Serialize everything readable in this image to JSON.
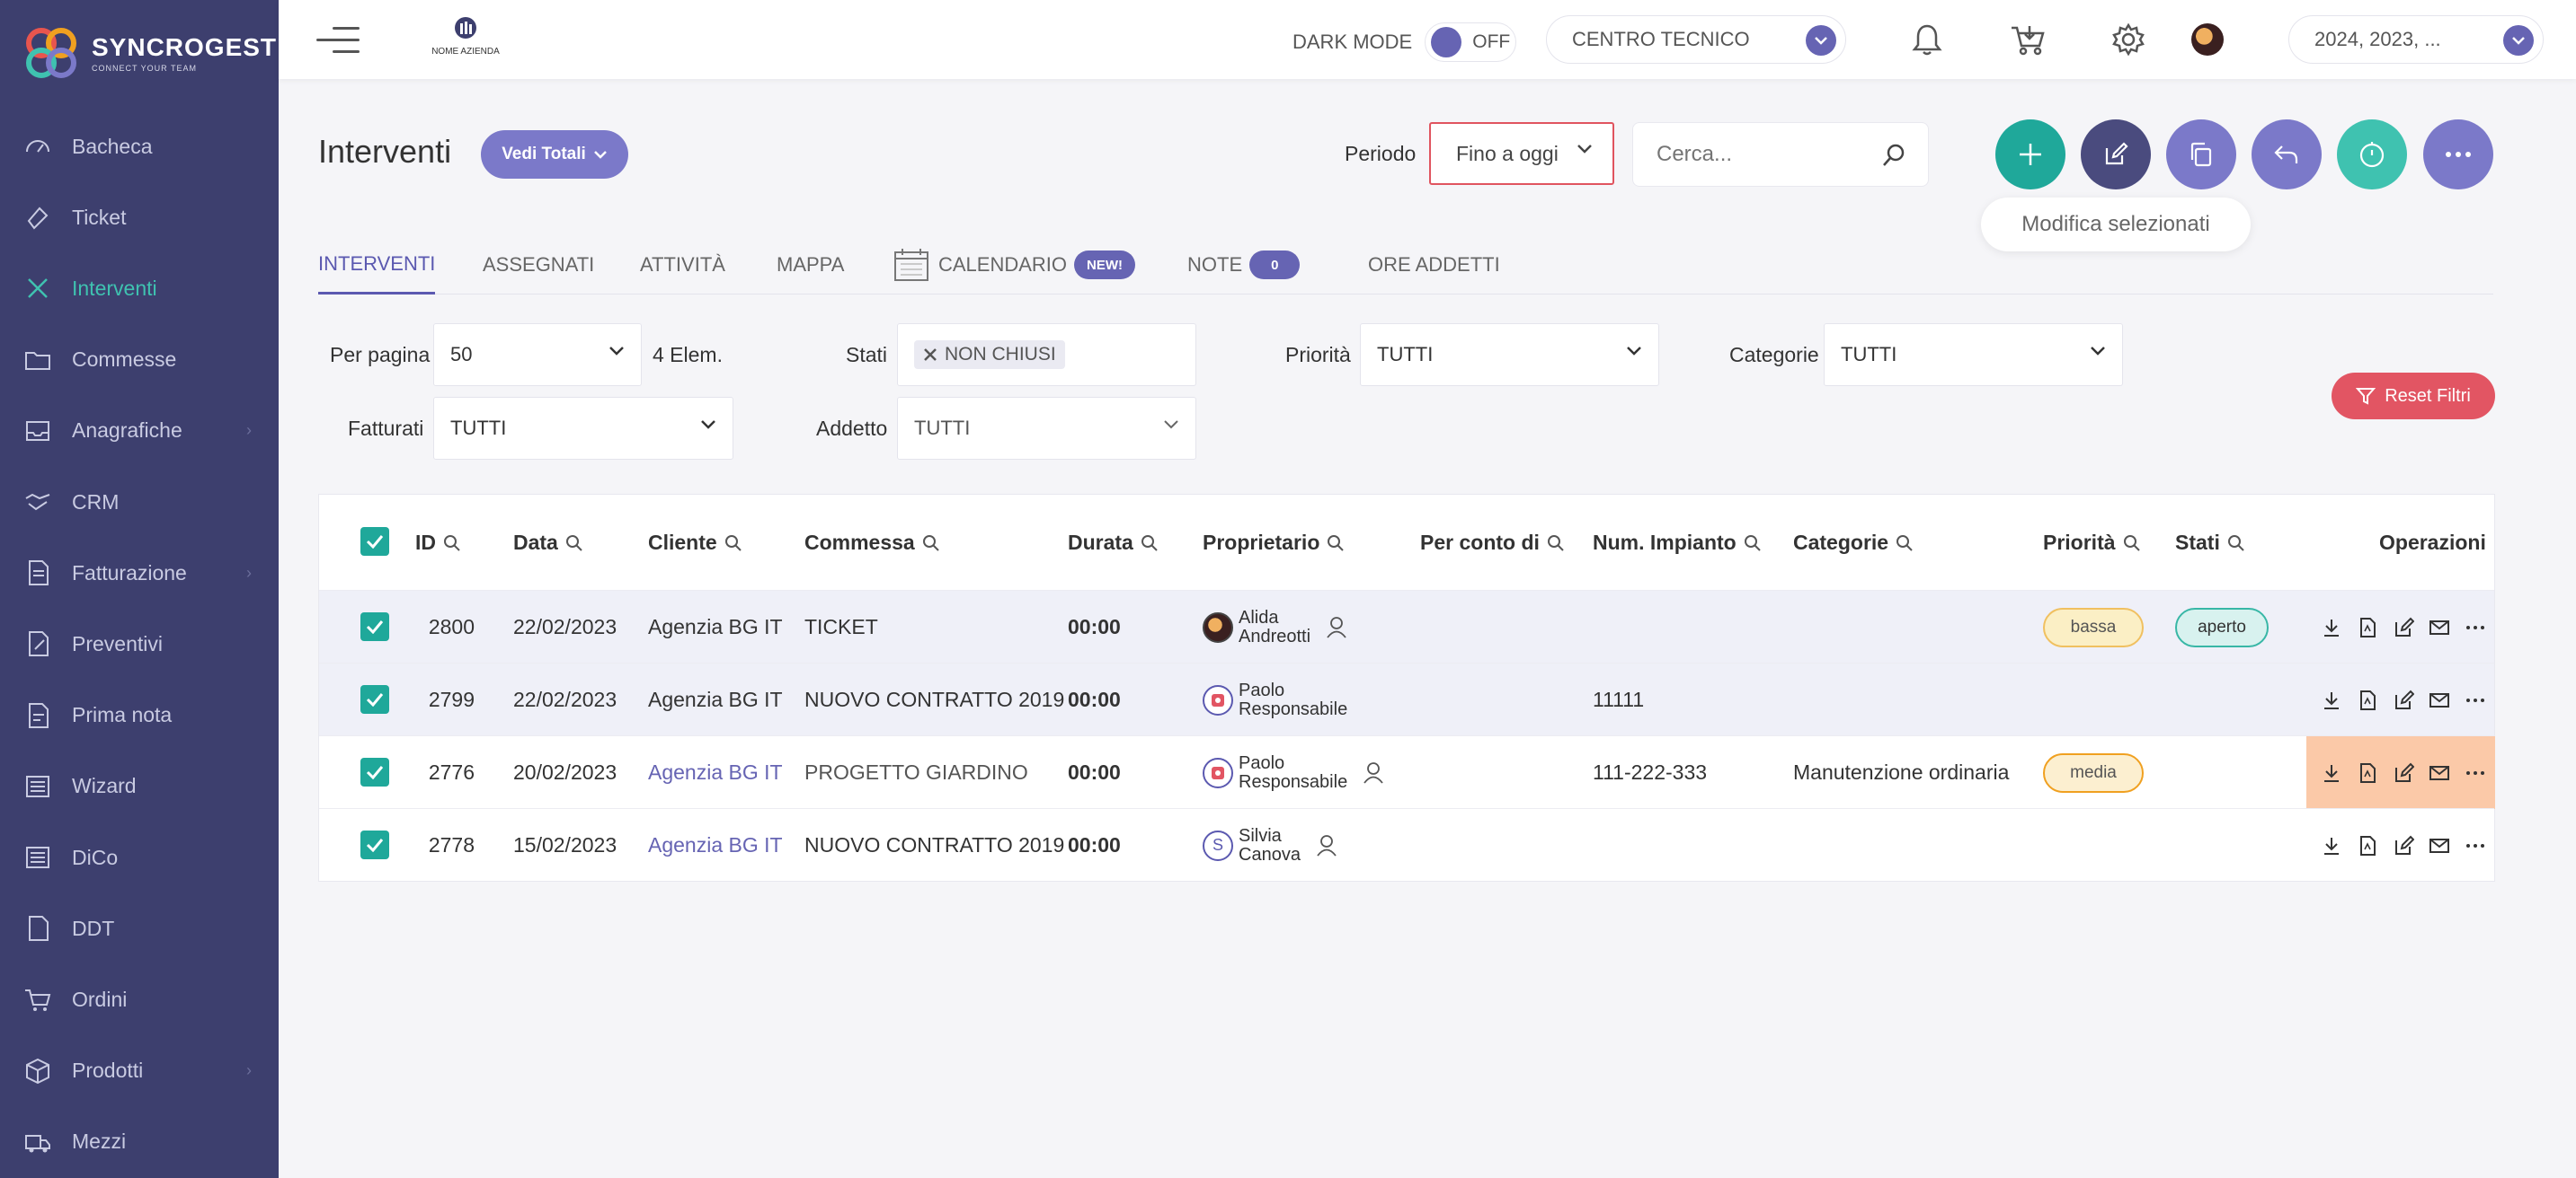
{
  "app": {
    "title": "SYNCROGEST",
    "subtitle": "CONNECT YOUR TEAM"
  },
  "sidebar": {
    "items": [
      {
        "label": "Bacheca",
        "icon": "dashboard-icon"
      },
      {
        "label": "Ticket",
        "icon": "ticket-icon"
      },
      {
        "label": "Interventi",
        "icon": "tools-icon",
        "active": true
      },
      {
        "label": "Commesse",
        "icon": "folder-icon"
      },
      {
        "label": "Anagrafiche",
        "icon": "inbox-icon",
        "has_children": true
      },
      {
        "label": "CRM",
        "icon": "handshake-icon"
      },
      {
        "label": "Fatturazione",
        "icon": "invoice-icon",
        "has_children": true
      },
      {
        "label": "Preventivi",
        "icon": "quote-icon"
      },
      {
        "label": "Prima nota",
        "icon": "note-icon"
      },
      {
        "label": "Wizard",
        "icon": "wizard-icon"
      },
      {
        "label": "DiCo",
        "icon": "dico-icon"
      },
      {
        "label": "DDT",
        "icon": "ddt-icon"
      },
      {
        "label": "Ordini",
        "icon": "cart-icon"
      },
      {
        "label": "Prodotti",
        "icon": "box-icon",
        "has_children": true
      },
      {
        "label": "Mezzi",
        "icon": "truck-icon"
      }
    ]
  },
  "topbar": {
    "brand_small": "NOME AZIENDA",
    "dark_mode_label": "DARK MODE",
    "dark_mode_state": "OFF",
    "center_select": "CENTRO TECNICO",
    "year_select": "2024, 2023, ..."
  },
  "header": {
    "title": "Interventi",
    "vedi_totali": "Vedi Totali",
    "periodo_label": "Periodo",
    "periodo_value": "Fino a oggi",
    "search_placeholder": "Cerca...",
    "tooltip": "Modifica selezionati"
  },
  "tabs": [
    {
      "label": "INTERVENTI",
      "active": true
    },
    {
      "label": "ASSEGNATI"
    },
    {
      "label": "ATTIVITÀ"
    },
    {
      "label": "MAPPA"
    },
    {
      "label": "CALENDARIO",
      "badge": "NEW!"
    },
    {
      "label": "NOTE",
      "badge": "0"
    },
    {
      "label": "ORE ADDETTI"
    }
  ],
  "filters": {
    "per_pagina_label": "Per pagina",
    "per_pagina_value": "50",
    "count_text": "4 Elem.",
    "stati_label": "Stati",
    "stati_chip": "NON CHIUSI",
    "priorita_label": "Priorità",
    "priorita_value": "TUTTI",
    "categorie_label": "Categorie",
    "categorie_value": "TUTTI",
    "fatturati_label": "Fatturati",
    "fatturati_value": "TUTTI",
    "addetto_label": "Addetto",
    "addetto_value": "TUTTI",
    "reset_label": "Reset Filtri"
  },
  "table": {
    "columns": [
      "ID",
      "Data",
      "Cliente",
      "Commessa",
      "Durata",
      "Proprietario",
      "Per conto di",
      "Num. Impianto",
      "Categorie",
      "Priorità",
      "Stati",
      "Operazioni"
    ],
    "rows": [
      {
        "id": "2800",
        "data": "22/02/2023",
        "cliente": "Agenzia BG IT",
        "commessa": "TICKET",
        "durata": "00:00",
        "owner_first": "Alida",
        "owner_last": "Andreotti",
        "owner_initial": "",
        "impianto": "",
        "categorie": "",
        "priorita": "bassa",
        "stato": "aperto"
      },
      {
        "id": "2799",
        "data": "22/02/2023",
        "cliente": "Agenzia BG IT",
        "commessa": "NUOVO CONTRATTO 2019",
        "durata": "00:00",
        "owner_first": "Paolo",
        "owner_last": "Responsabile",
        "owner_initial": "",
        "impianto": "11111",
        "categorie": "",
        "priorita": "",
        "stato": ""
      },
      {
        "id": "2776",
        "data": "20/02/2023",
        "cliente": "Agenzia BG IT",
        "commessa": "PROGETTO GIARDINO",
        "durata": "00:00",
        "owner_first": "Paolo",
        "owner_last": "Responsabile",
        "owner_initial": "",
        "impianto": "111-222-333",
        "categorie": "Manutenzione ordinaria",
        "priorita": "media",
        "stato": ""
      },
      {
        "id": "2778",
        "data": "15/02/2023",
        "cliente": "Agenzia BG IT",
        "commessa": "NUOVO CONTRATTO 2019",
        "durata": "00:00",
        "owner_first": "Silvia",
        "owner_last": "Canova",
        "owner_initial": "S",
        "impianto": "",
        "categorie": "",
        "priorita": "",
        "stato": ""
      }
    ]
  },
  "colors": {
    "sidebar_bg": "#3d3f6e",
    "accent": "#6664b3",
    "teal": "#3fc2b0",
    "danger": "#e25563"
  }
}
